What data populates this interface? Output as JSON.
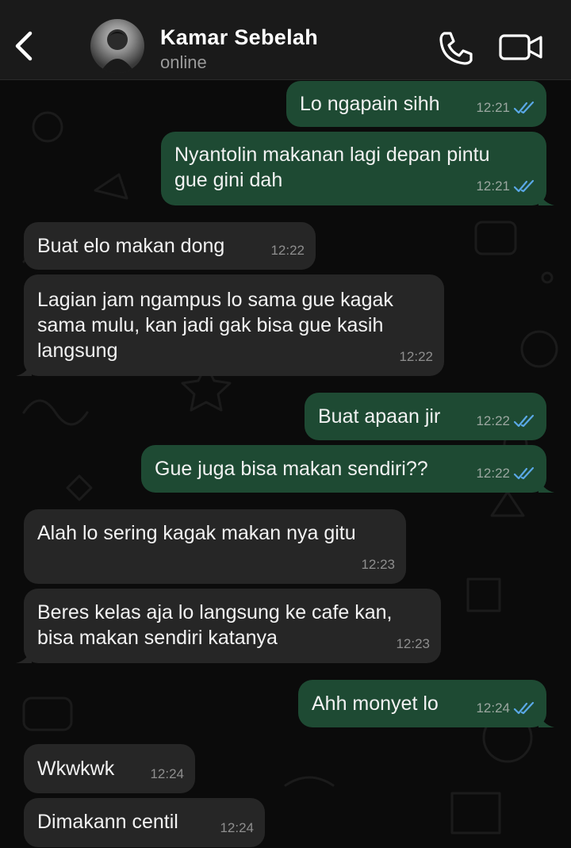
{
  "header": {
    "contact_name": "Kamar Sebelah",
    "status": "online"
  },
  "colors": {
    "outgoing_bubble": "#1e4a33",
    "incoming_bubble": "#262626",
    "read_ticks": "#5aa8e6",
    "background": "#0b0b0b"
  },
  "icons": {
    "back": "chevron-left-icon",
    "call": "phone-icon",
    "video": "video-camera-icon",
    "read": "double-check-icon"
  },
  "messages": [
    {
      "dir": "out",
      "text": "Lo ngapain sihh",
      "time": "12:21",
      "read": true
    },
    {
      "dir": "out",
      "text": "Nyantolin makanan lagi depan pintu\ngue gini dah",
      "time": "12:21",
      "read": true
    },
    {
      "dir": "in",
      "text": "Buat elo makan dong",
      "time": "12:22"
    },
    {
      "dir": "in",
      "text": "Lagian jam ngampus lo sama gue kagak\nsama mulu, kan jadi gak bisa gue kasih\nlangsung",
      "time": "12:22"
    },
    {
      "dir": "out",
      "text": "Buat apaan jir",
      "time": "12:22",
      "read": true
    },
    {
      "dir": "out",
      "text": "Gue juga bisa makan sendiri??",
      "time": "12:22",
      "read": true
    },
    {
      "dir": "in",
      "text": "Alah lo sering kagak makan nya gitu",
      "time": "12:23"
    },
    {
      "dir": "in",
      "text": "Beres kelas aja lo langsung ke cafe kan,\nbisa makan sendiri katanya",
      "time": "12:23"
    },
    {
      "dir": "out",
      "text": "Ahh monyet lo",
      "time": "12:24",
      "read": true
    },
    {
      "dir": "in",
      "text": "Wkwkwk",
      "time": "12:24"
    },
    {
      "dir": "in",
      "text": "Dimakann centil",
      "time": "12:24"
    }
  ]
}
